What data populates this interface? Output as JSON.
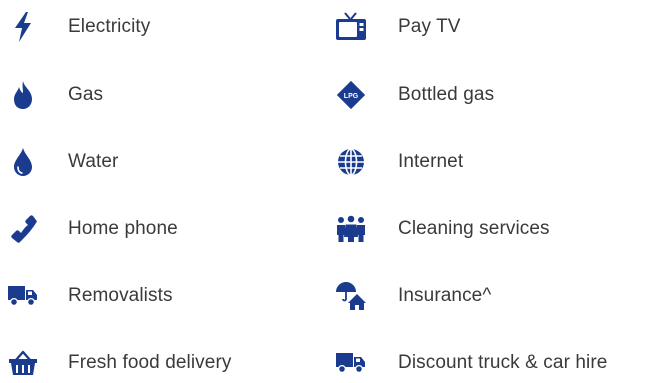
{
  "colors": {
    "icon": "#1b3b8f",
    "text": "#3a3a3a",
    "background": "#ffffff"
  },
  "services": {
    "left": [
      {
        "label": "Electricity",
        "icon": "lightning-bolt-icon"
      },
      {
        "label": "Gas",
        "icon": "flame-icon"
      },
      {
        "label": "Water",
        "icon": "water-drop-icon"
      },
      {
        "label": "Home phone",
        "icon": "phone-handset-icon"
      },
      {
        "label": "Removalists",
        "icon": "truck-icon"
      },
      {
        "label": "Fresh food delivery",
        "icon": "shopping-basket-icon"
      }
    ],
    "right": [
      {
        "label": "Pay TV",
        "icon": "television-icon"
      },
      {
        "label": "Bottled gas",
        "icon": "lpg-diamond-icon",
        "icon_text": "LPG"
      },
      {
        "label": "Internet",
        "icon": "globe-icon"
      },
      {
        "label": "Cleaning services",
        "icon": "people-group-icon"
      },
      {
        "label": "Insurance^",
        "icon": "umbrella-house-icon"
      },
      {
        "label": "Discount truck & car hire",
        "icon": "truck-icon"
      }
    ]
  }
}
